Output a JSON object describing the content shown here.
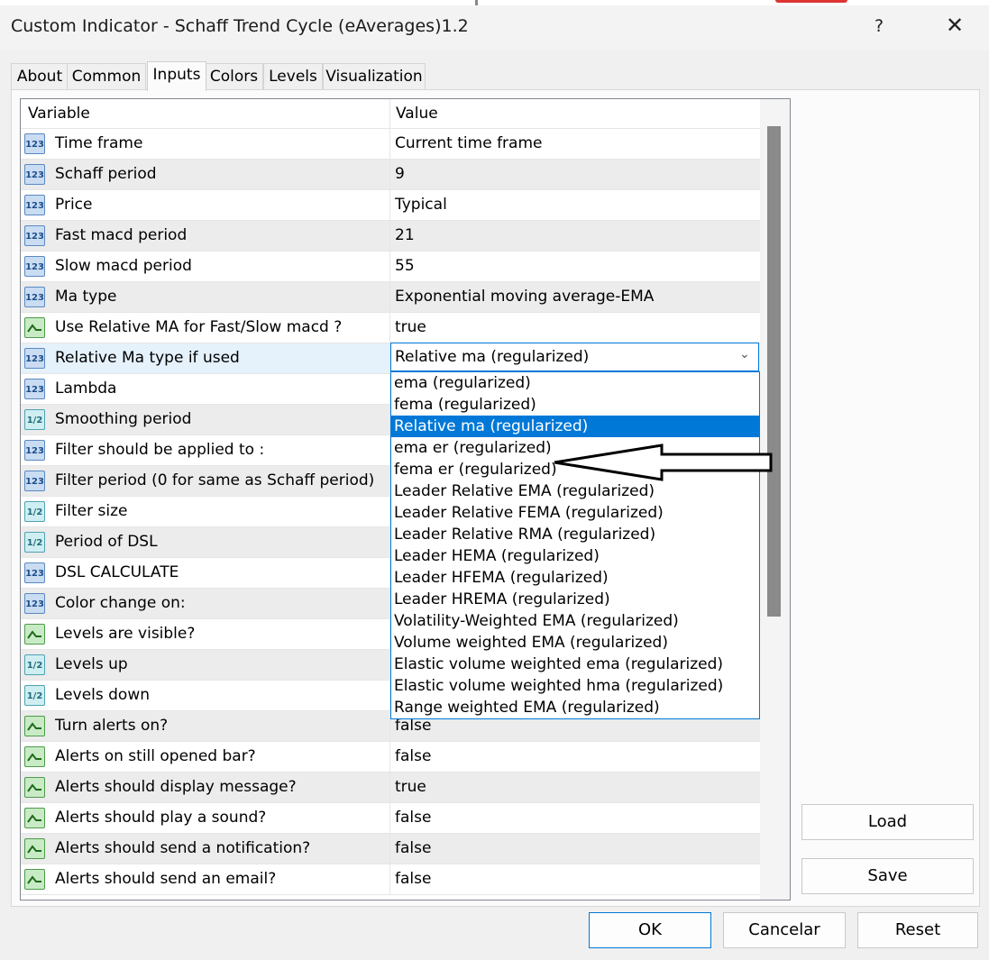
{
  "window": {
    "title": "Custom Indicator - Schaff Trend Cycle (eAverages)1.2",
    "help_label": "?",
    "close_label": "✕"
  },
  "tabs": [
    {
      "label": "About"
    },
    {
      "label": "Common"
    },
    {
      "label": "Inputs"
    },
    {
      "label": "Colors"
    },
    {
      "label": "Levels"
    },
    {
      "label": "Visualization"
    }
  ],
  "grid": {
    "headers": {
      "variable": "Variable",
      "value": "Value"
    },
    "rows": [
      {
        "icon": "123",
        "type": "num",
        "name": "Time frame",
        "value": "Current time frame"
      },
      {
        "icon": "123",
        "type": "num",
        "name": "Schaff period",
        "value": "9"
      },
      {
        "icon": "123",
        "type": "num",
        "name": "Price",
        "value": "Typical"
      },
      {
        "icon": "123",
        "type": "num",
        "name": "Fast macd period",
        "value": "21"
      },
      {
        "icon": "123",
        "type": "num",
        "name": "Slow macd period",
        "value": "55"
      },
      {
        "icon": "123",
        "type": "num",
        "name": "Ma  type",
        "value": "Exponential moving average-EMA"
      },
      {
        "icon": "bool",
        "type": "bool",
        "name": "Use Relative MA for Fast/Slow macd ?",
        "value": "true"
      },
      {
        "icon": "123",
        "type": "num",
        "name": "Relative Ma type if used",
        "value": ""
      },
      {
        "icon": "123",
        "type": "num",
        "name": "Lambda",
        "value": ""
      },
      {
        "icon": "1/2",
        "type": "dbl",
        "name": "Smoothing period",
        "value": ""
      },
      {
        "icon": "123",
        "type": "num",
        "name": "Filter should be applied to :",
        "value": ""
      },
      {
        "icon": "123",
        "type": "num",
        "name": "Filter period (0 for same as Schaff period)",
        "value": ""
      },
      {
        "icon": "1/2",
        "type": "dbl",
        "name": "Filter size",
        "value": ""
      },
      {
        "icon": "1/2",
        "type": "dbl",
        "name": "Period of DSL",
        "value": ""
      },
      {
        "icon": "123",
        "type": "num",
        "name": "DSL CALCULATE",
        "value": ""
      },
      {
        "icon": "123",
        "type": "num",
        "name": "Color change on:",
        "value": ""
      },
      {
        "icon": "bool",
        "type": "bool",
        "name": "Levels are visible?",
        "value": ""
      },
      {
        "icon": "1/2",
        "type": "dbl",
        "name": "Levels up",
        "value": ""
      },
      {
        "icon": "1/2",
        "type": "dbl",
        "name": "Levels down",
        "value": ""
      },
      {
        "icon": "bool",
        "type": "bool",
        "name": "Turn alerts on?",
        "value": "false"
      },
      {
        "icon": "bool",
        "type": "bool",
        "name": "Alerts on still opened bar?",
        "value": "false"
      },
      {
        "icon": "bool",
        "type": "bool",
        "name": "Alerts should display message?",
        "value": "true"
      },
      {
        "icon": "bool",
        "type": "bool",
        "name": "Alerts should play a sound?",
        "value": "false"
      },
      {
        "icon": "bool",
        "type": "bool",
        "name": "Alerts should send a notification?",
        "value": "false"
      },
      {
        "icon": "bool",
        "type": "bool",
        "name": "Alerts should send an email?",
        "value": "false"
      }
    ]
  },
  "combo": {
    "selected": "Relative ma (regularized)",
    "options": [
      "ema (regularized)",
      "fema (regularized)",
      "Relative ma (regularized)",
      "ema er (regularized)",
      "fema er (regularized)",
      "Leader Relative EMA (regularized)",
      "Leader Relative FEMA (regularized)",
      "Leader Relative RMA (regularized)",
      "Leader HEMA (regularized)",
      "Leader HFEMA (regularized)",
      "Leader HREMA (regularized)",
      "Volatility-Weighted EMA (regularized)",
      "Volume weighted EMA (regularized)",
      "Elastic volume weighted ema (regularized)",
      "Elastic volume weighted hma (regularized)",
      "Range weighted EMA (regularized)"
    ]
  },
  "buttons": {
    "load": "Load",
    "save": "Save",
    "ok": "OK",
    "cancel": "Cancelar",
    "reset": "Reset"
  },
  "colors": {
    "accent": "#0078d7",
    "selected_row": "#e5f1fb",
    "alt_row": "#ececec"
  }
}
